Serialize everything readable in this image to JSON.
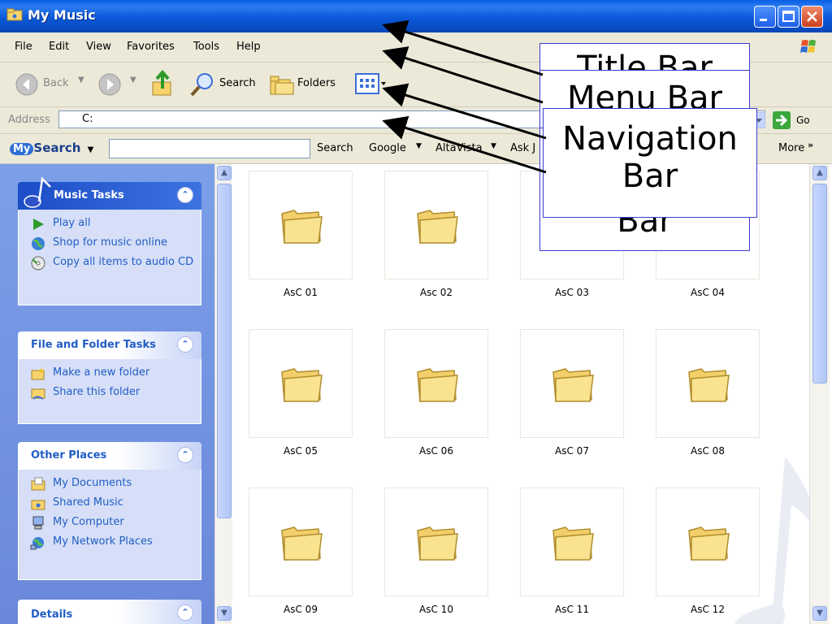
{
  "window": {
    "title": "My Music"
  },
  "menu": {
    "items": [
      "File",
      "Edit",
      "View",
      "Favorites",
      "Tools",
      "Help"
    ]
  },
  "toolbar": {
    "back_label": "Back",
    "search_label": "Search",
    "folders_label": "Folders"
  },
  "address": {
    "label": "Address",
    "value": "C:",
    "go_label": "Go"
  },
  "searchbar": {
    "brand": "MySearch",
    "brand_my": "My",
    "brand_rest": "Search",
    "search_button": "Search",
    "engines": [
      "Google",
      "AltaVista",
      "Ask J"
    ],
    "more_label": "More"
  },
  "taskpane": {
    "groups": [
      {
        "title": "Music Tasks",
        "items": [
          "Play all",
          "Shop for music online",
          "Copy all items to audio CD"
        ]
      },
      {
        "title": "File and Folder Tasks",
        "items": [
          "Make a new folder",
          "Share this folder"
        ]
      },
      {
        "title": "Other Places",
        "items": [
          "My Documents",
          "Shared Music",
          "My Computer",
          "My Network Places"
        ]
      },
      {
        "title": "Details"
      }
    ]
  },
  "folders": [
    "AsC 01",
    "Asc 02",
    "AsC 03",
    "AsC 04",
    "AsC 05",
    "AsC 06",
    "AsC 07",
    "AsC 08",
    "AsC 09",
    "AsC 10",
    "AsC 11",
    "AsC 12"
  ],
  "callouts": {
    "title_bar": "Title Bar",
    "menu_bar": "Menu Bar",
    "navigation_bar": "Navigation Bar",
    "back_bar_fragment": "Bar"
  },
  "colors": {
    "title_bar": "#0a5fe4",
    "task_pane": "#7b9fe8",
    "link_text": "#215dc6",
    "callout_border": "#3b3bd0"
  }
}
